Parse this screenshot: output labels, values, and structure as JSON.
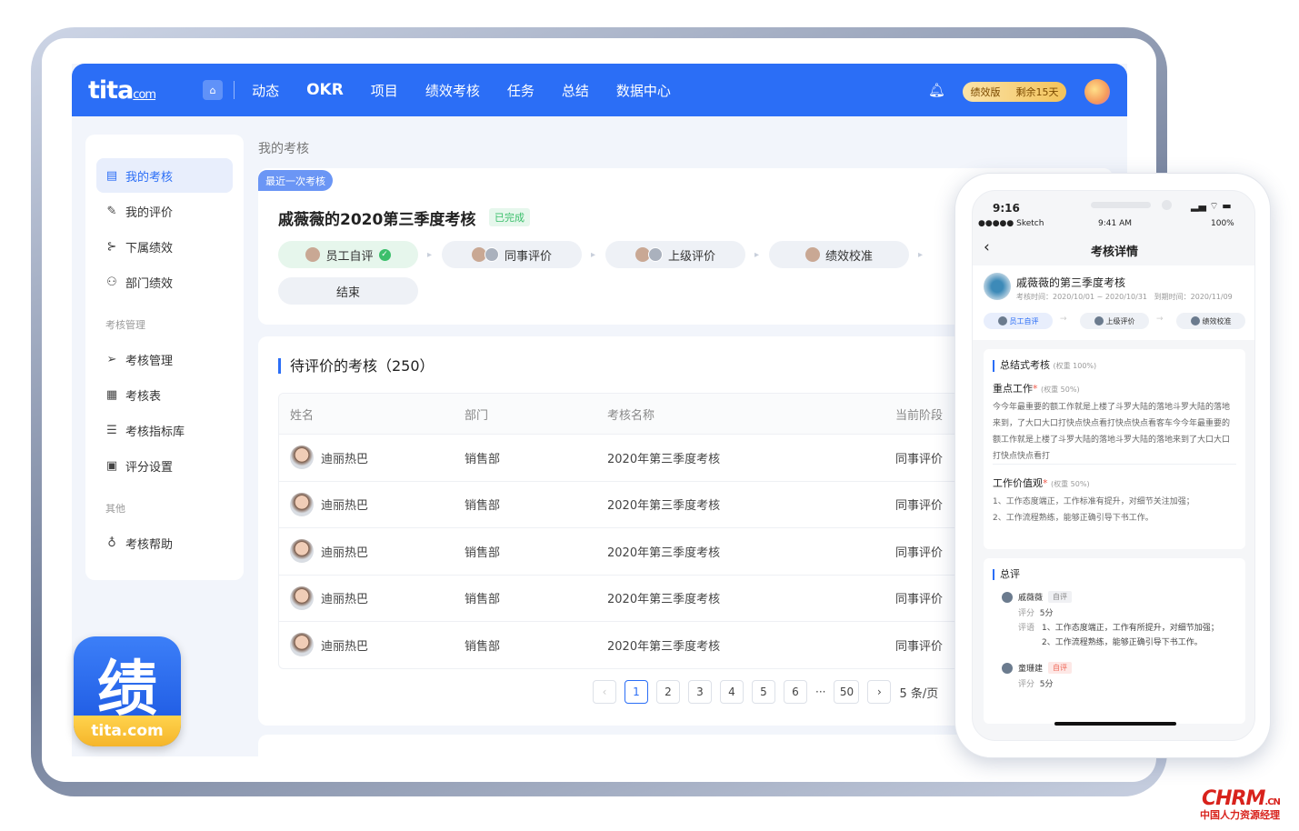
{
  "topbar": {
    "logo": "tita",
    "logo_suffix": "com",
    "nav": [
      "动态",
      "OKR",
      "项目",
      "绩效考核",
      "任务",
      "总结",
      "数据中心"
    ],
    "badge_left": "绩效版",
    "badge_right": "剩余15天"
  },
  "sidebar": {
    "items": [
      {
        "label": "我的考核",
        "icon": "clipboard-icon"
      },
      {
        "label": "我的评价",
        "icon": "pen-icon"
      },
      {
        "label": "下属绩效",
        "icon": "tree-icon"
      },
      {
        "label": "部门绩效",
        "icon": "org-icon"
      }
    ],
    "group1": "考核管理",
    "manage_items": [
      {
        "label": "考核管理",
        "icon": "send-icon"
      },
      {
        "label": "考核表",
        "icon": "grid-icon"
      },
      {
        "label": "考核指标库",
        "icon": "database-icon"
      },
      {
        "label": "评分设置",
        "icon": "settings-doc-icon"
      }
    ],
    "group2": "其他",
    "other_items": [
      {
        "label": "考核帮助",
        "icon": "bulb-icon"
      }
    ]
  },
  "breadcrumb": "我的考核",
  "recent": {
    "tag": "最近一次考核",
    "title": "戚薇薇的2020第三季度考核",
    "status": "已完成",
    "steps": [
      "员工自评",
      "同事评价",
      "上级评价",
      "绩效校准",
      "结束"
    ]
  },
  "pending": {
    "title": "待评价的考核（250）",
    "columns": [
      "姓名",
      "部门",
      "考核名称",
      "当前阶段"
    ],
    "rows": [
      {
        "name": "迪丽热巴",
        "dept": "销售部",
        "review": "2020年第三季度考核",
        "stage": "同事评价"
      },
      {
        "name": "迪丽热巴",
        "dept": "销售部",
        "review": "2020年第三季度考核",
        "stage": "同事评价"
      },
      {
        "name": "迪丽热巴",
        "dept": "销售部",
        "review": "2020年第三季度考核",
        "stage": "同事评价"
      },
      {
        "name": "迪丽热巴",
        "dept": "销售部",
        "review": "2020年第三季度考核",
        "stage": "同事评价"
      },
      {
        "name": "迪丽热巴",
        "dept": "销售部",
        "review": "2020年第三季度考核",
        "stage": "同事评价"
      }
    ],
    "pager": {
      "pages": [
        "1",
        "2",
        "3",
        "4",
        "5",
        "6"
      ],
      "ellipsis": "···",
      "last": "50",
      "per_page": "5 条/页",
      "current": 1
    }
  },
  "app_icon": {
    "glyph": "绩",
    "brand": "tita.com"
  },
  "phone": {
    "status_time": "9:16",
    "carrier": "●●●●● Sketch",
    "sketch_time": "9:41 AM",
    "battery": "100%",
    "header_title": "考核详情",
    "review_title": "戚薇薇的第三季度考核",
    "review_meta": "考核时间：2020/10/01 ~ 2020/10/31   到期时间：2020/11/09",
    "steps": [
      "员工自评",
      "上级评价",
      "绩效校准"
    ],
    "section1": {
      "title": "总结式考核",
      "weight": "(权重 100%)",
      "item1_title": "重点工作",
      "item1_weight": "(权重 50%)",
      "item1_text": "今今年最重要的额工作就是上楼了斗罗大陆的落地斗罗大陆的落地来到，了大口大口打快点快点看打快点快点看客车今今年最重要的额工作就是上楼了斗罗大陆的落地斗罗大陆的落地来到了大口大口打快点快点看打",
      "item2_title": "工作价值观",
      "item2_weight": "(权重 50%)",
      "item2_line1": "1、工作态度端正，工作标准有提升，对细节关注加强；",
      "item2_line2": "2、工作流程熟练，能够正确引导下书工作。"
    },
    "section2": {
      "title": "总评",
      "person1": "戚薇薇",
      "person1_tag": "自评",
      "score_label": "评分",
      "score1": "5分",
      "comment_label": "评语",
      "comment1_line1": "1、工作态度端正，工作有所提升，对细节加强；",
      "comment1_line2": "2、工作流程熟练，能够正确引导下书工作。",
      "person2": "童珊建",
      "person2_tag": "自评",
      "score2": "5分"
    }
  },
  "watermark": {
    "brand": "CHRM",
    "suffix": ".CN",
    "sub": "中国人力资源经理"
  },
  "colors": {
    "primary": "#2b6ef6",
    "success": "#3bbf6b",
    "badge": "#f3c35a"
  }
}
